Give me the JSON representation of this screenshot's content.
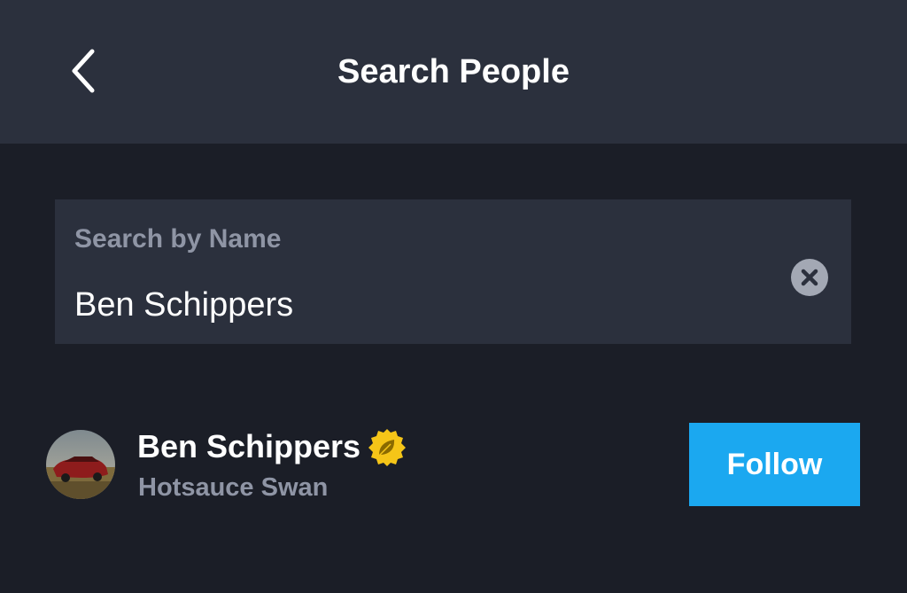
{
  "header": {
    "title": "Search People",
    "back_icon": "chevron-left-icon"
  },
  "search": {
    "label": "Search by Name",
    "value": "Ben Schippers",
    "clear_icon": "close-circle-icon"
  },
  "results": [
    {
      "name": "Ben Schippers",
      "handle": "Hotsauce Swan",
      "avatar": "avatar-photo-red-car",
      "badge_icon": "leaf-badge-icon",
      "follow_label": "Follow"
    }
  ],
  "colors": {
    "background": "#1b1e27",
    "header_bg": "#2b303d",
    "field_bg": "#2b303d",
    "accent": "#1ba8f0",
    "badge": "#f5c518",
    "muted_text": "#8f95a5"
  }
}
